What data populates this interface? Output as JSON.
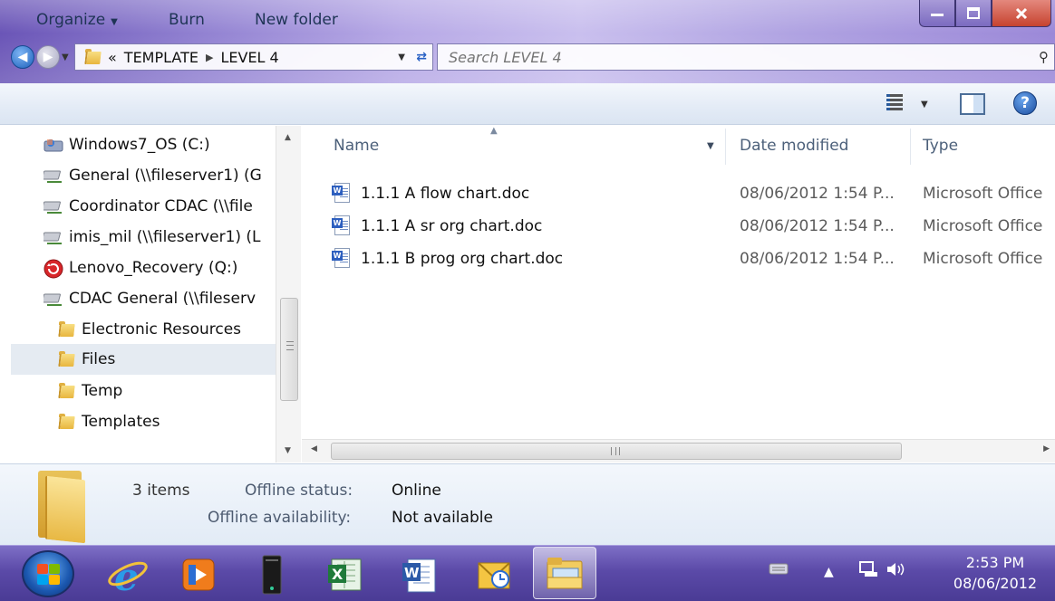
{
  "window": {
    "address": {
      "prefix": "«",
      "crumbs": [
        "TEMPLATE",
        "LEVEL 4"
      ]
    },
    "search_placeholder": "Search LEVEL 4"
  },
  "toolbar": {
    "organize": "Organize",
    "burn": "Burn",
    "new_folder": "New folder"
  },
  "nav": {
    "items": [
      {
        "label": "Windows7_OS (C:)",
        "icon": "drive-icon"
      },
      {
        "label": "General (\\\\fileserver1) (G",
        "icon": "network-drive-icon"
      },
      {
        "label": "Coordinator CDAC (\\\\file",
        "icon": "network-drive-icon"
      },
      {
        "label": "imis_mil (\\\\fileserver1) (L",
        "icon": "network-drive-icon"
      },
      {
        "label": "Lenovo_Recovery (Q:)",
        "icon": "recovery-drive-icon"
      },
      {
        "label": "CDAC General (\\\\fileserv",
        "icon": "network-drive-icon"
      },
      {
        "label": "Electronic Resources",
        "icon": "folder-icon"
      },
      {
        "label": "Files",
        "icon": "folder-icon",
        "selected": true
      },
      {
        "label": "Temp",
        "icon": "folder-icon"
      },
      {
        "label": "Templates",
        "icon": "folder-icon"
      }
    ]
  },
  "list": {
    "columns": {
      "name": "Name",
      "date": "Date modified",
      "type": "Type"
    },
    "rows": [
      {
        "name": "1.1.1 A flow chart.doc",
        "date": "08/06/2012 1:54 P...",
        "type": "Microsoft Office"
      },
      {
        "name": "1.1.1 A sr org chart.doc",
        "date": "08/06/2012 1:54 P...",
        "type": "Microsoft Office"
      },
      {
        "name": "1.1.1 B prog org chart.doc",
        "date": "08/06/2012 1:54 P...",
        "type": "Microsoft Office"
      }
    ]
  },
  "details": {
    "count": "3 items",
    "offline_status_label": "Offline status:",
    "offline_status_value": "Online",
    "offline_availability_label": "Offline availability:",
    "offline_availability_value": "Not available"
  },
  "taskbar": {
    "time": "2:53 PM",
    "date": "08/06/2012",
    "apps": [
      "internet-explorer-icon",
      "media-player-icon",
      "server-tower-icon",
      "excel-icon",
      "word-icon",
      "outlook-icon",
      "explorer-icon"
    ]
  },
  "colors": {
    "accent": "#5b4aa8",
    "selection": "#e5ebf2",
    "command_text": "#1e3455"
  }
}
